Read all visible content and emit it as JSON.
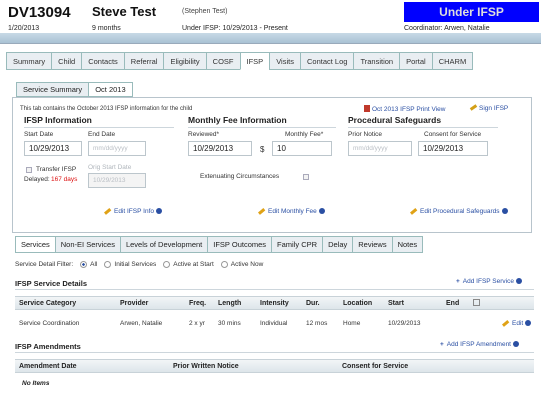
{
  "header": {
    "client_id": "DV13094",
    "client_name": "Steve Test",
    "client_preferred": "(Stephen Test)",
    "date": "1/20/2013",
    "age": "9 months",
    "ifsp_range": "Under IFSP: 10/29/2013 - Present",
    "status": "Under IFSP",
    "coordinator": "Coordinator: Arwen, Natalie"
  },
  "main_tabs": [
    "Summary",
    "Child",
    "Contacts",
    "Referral",
    "Eligibility",
    "COSF",
    "IFSP",
    "Visits",
    "Contact Log",
    "Transition",
    "Portal",
    "CHARM"
  ],
  "sub_tabs": [
    "Service Summary",
    "Oct 2013"
  ],
  "intro": "This tab contains the October 2013 IFSP information for the child",
  "links": {
    "print_view": "Oct 2013 IFSP Print View",
    "sign": "Sign IFSP"
  },
  "ifsp_info": {
    "title": "IFSP Information",
    "start_label": "Start Date",
    "start_value": "10/29/2013",
    "end_label": "End Date",
    "end_placeholder": "mm/dd/yyyy",
    "transfer_label": "Transfer IFSP",
    "orig_start_label": "Orig Start Date",
    "orig_start_value": "10/29/2013",
    "delayed_label": "Delayed:",
    "delayed_value": "167 days",
    "edit": "Edit IFSP Info"
  },
  "monthly_fee": {
    "title": "Monthly Fee Information",
    "reviewed_label": "Reviewed*",
    "reviewed_value": "10/29/2013",
    "fee_label": "Monthly Fee*",
    "currency": "$",
    "fee_value": "10",
    "extenuating": "Extenuating Circumstances",
    "edit": "Edit Monthly Fee"
  },
  "safeguards": {
    "title": "Procedural Safeguards",
    "prior_label": "Prior Notice",
    "prior_placeholder": "mm/dd/yyyy",
    "consent_label": "Consent for Service",
    "consent_value": "10/29/2013",
    "edit": "Edit Procedural Safeguards"
  },
  "lower_tabs": [
    "Services",
    "Non-EI Services",
    "Levels of Development",
    "IFSP Outcomes",
    "Family CPR",
    "Delay",
    "Reviews",
    "Notes"
  ],
  "filter": {
    "label": "Service Detail Filter:",
    "options": [
      "All",
      "Initial Services",
      "Active at Start",
      "Active Now"
    ]
  },
  "service_details": {
    "title": "IFSP Service Details",
    "add": "Add IFSP Service",
    "columns": [
      "Service Category",
      "Provider",
      "Freq.",
      "Length",
      "Intensity",
      "Dur.",
      "Location",
      "Start",
      "End"
    ],
    "rows": [
      {
        "category": "Service Coordination",
        "provider": "Arwen, Natalie",
        "freq": "2 x yr",
        "length": "30 mins",
        "intensity": "Individual",
        "dur": "12 mos",
        "location": "Home",
        "start": "10/29/2013",
        "end": "",
        "edit": "Edit"
      }
    ]
  },
  "amendments": {
    "title": "IFSP Amendments",
    "add": "Add IFSP Amendment",
    "columns": [
      "Amendment Date",
      "Prior Written Notice",
      "Consent for Service"
    ],
    "empty": "No Items"
  }
}
